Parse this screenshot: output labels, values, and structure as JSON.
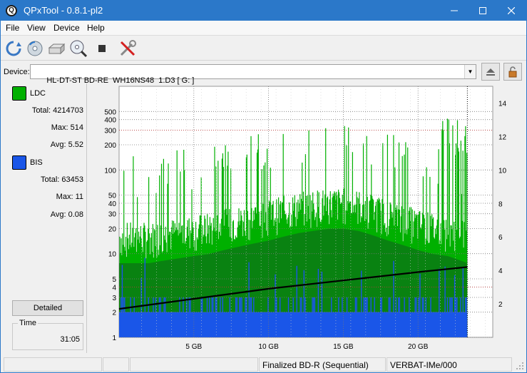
{
  "window": {
    "title": "QPxTool - 0.8.1-pl2",
    "app_icon_letter": "Q"
  },
  "menu": [
    "File",
    "View",
    "Device",
    "Help"
  ],
  "device": {
    "label": "Device:",
    "value": "HL-DT-ST BD-RE  WH16NS48  1.D3 [ G: ]"
  },
  "ldc": {
    "label": "LDC",
    "color": "#00b000",
    "total_label": "Total:",
    "total": "4214703",
    "max_label": "Max:",
    "max": "514",
    "avg_label": "Avg:",
    "avg": "5.52"
  },
  "bis": {
    "label": "BIS",
    "color": "#1a56e8",
    "total_label": "Total:",
    "total": "63453",
    "max_label": "Max:",
    "max": "11",
    "avg_label": "Avg:",
    "avg": "0.08"
  },
  "detailed_label": "Detailed",
  "time": {
    "label": "Time",
    "value": "31:05"
  },
  "status": {
    "cell3": "Finalized BD-R (Sequential)",
    "cell4": "VERBAT-IMe/000"
  },
  "chart_data": {
    "type": "area",
    "left_axis": {
      "scale": "log",
      "range": [
        1,
        1000
      ],
      "ticks": [
        1,
        2,
        3,
        4,
        5,
        10,
        20,
        30,
        40,
        50,
        100,
        200,
        300,
        400,
        500
      ]
    },
    "right_axis": {
      "range": [
        0,
        15
      ],
      "ticks": [
        2,
        4,
        6,
        8,
        10,
        12,
        14
      ]
    },
    "x_axis": {
      "unit": "GB",
      "range": [
        0,
        25
      ],
      "ticks": [
        5,
        10,
        15,
        20
      ],
      "tick_labels": [
        "5 GB",
        "10 GB",
        "15 GB",
        "20 GB"
      ],
      "data_end": 23.3
    },
    "grid": true,
    "series": [
      {
        "name": "LDC",
        "color": "#00b000",
        "x": [
          0,
          2,
          4,
          6,
          8,
          10,
          12,
          14,
          15,
          16,
          18,
          20,
          21,
          22,
          23.3
        ],
        "y": [
          14,
          14,
          16,
          18,
          22,
          26,
          32,
          36,
          36,
          34,
          26,
          20,
          18,
          17,
          14
        ]
      },
      {
        "name": "BIS",
        "color": "#1a56e8",
        "x": [
          0,
          5,
          10,
          15,
          20,
          23.3
        ],
        "y": [
          2,
          2,
          2,
          2,
          2,
          2
        ]
      },
      {
        "name": "speed",
        "color": "#000000",
        "axis": "right",
        "x": [
          0,
          5,
          10,
          15,
          20,
          23.3
        ],
        "y": [
          1.7,
          2.3,
          2.9,
          3.4,
          3.9,
          4.2
        ]
      }
    ]
  }
}
